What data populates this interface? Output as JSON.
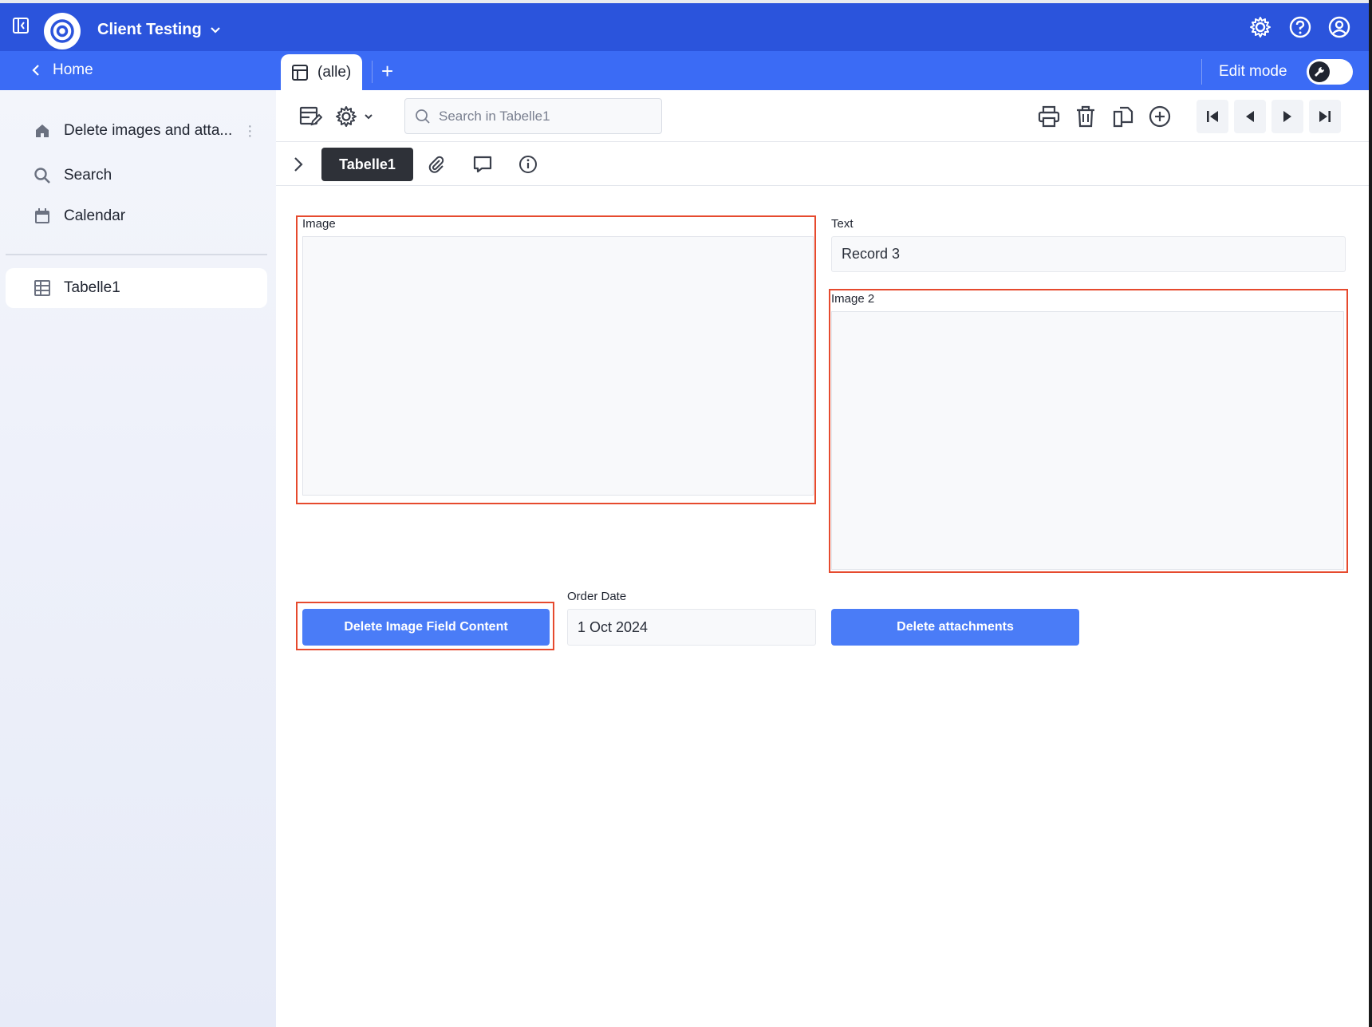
{
  "header": {
    "app_title": "Client Testing",
    "colors": {
      "primary": "#2b54dc",
      "secondary": "#3b6bf5",
      "highlight": "#e64a2e",
      "button": "#4a7cf7"
    }
  },
  "subbar": {
    "home_label": "Home",
    "tab_label": "(alle)",
    "add_tab": "+",
    "edit_mode_label": "Edit mode"
  },
  "sidebar": {
    "items": [
      {
        "label": "Delete images and atta...",
        "icon": "home-icon"
      },
      {
        "label": "Search",
        "icon": "search-icon"
      },
      {
        "label": "Calendar",
        "icon": "calendar-icon"
      },
      {
        "label": "Tabelle1",
        "icon": "table-icon"
      }
    ]
  },
  "toolbar": {
    "search_placeholder": "Search in Tabelle1"
  },
  "record_tabs": {
    "active": "Tabelle1"
  },
  "form": {
    "image_label": "Image",
    "text_label": "Text",
    "text_value": "Record 3",
    "image2_label": "Image 2",
    "order_date_label": "Order Date",
    "order_date_value": "1 Oct 2024",
    "delete_image_button": "Delete Image Field Content",
    "delete_attachments_button": "Delete attachments"
  }
}
